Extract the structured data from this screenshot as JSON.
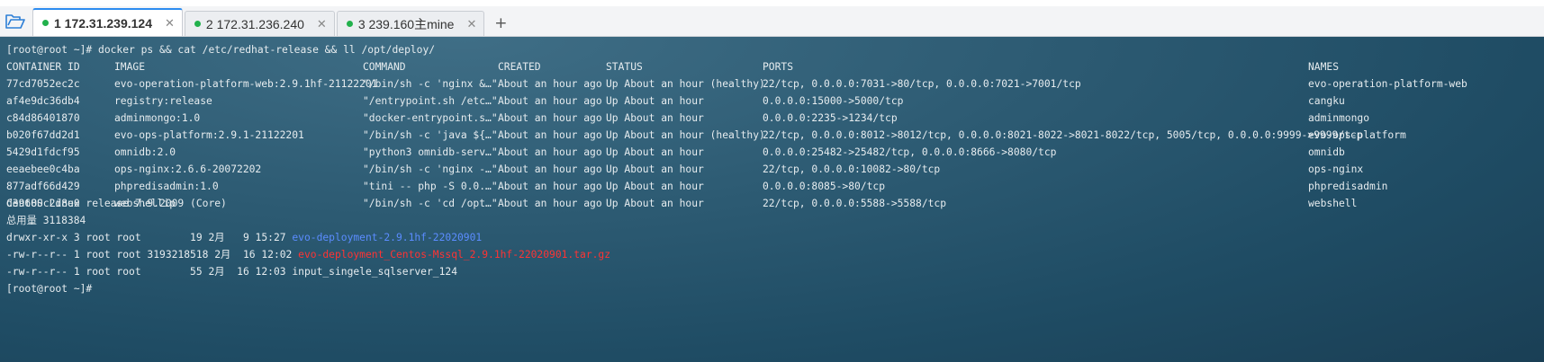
{
  "tabs": [
    {
      "label": "1 172.31.239.124",
      "active": true
    },
    {
      "label": "2 172.31.236.240",
      "active": false
    },
    {
      "label": "3 239.160主mine",
      "active": false
    }
  ],
  "add_tab_label": "+",
  "close_glyph": "✕",
  "terminal": {
    "command_line": "[root@root ~]# docker ps && cat /etc/redhat-release && ll /opt/deploy/",
    "docker_headers": {
      "id": "CONTAINER ID",
      "image": "IMAGE",
      "command": "COMMAND",
      "created": "CREATED",
      "status": "STATUS",
      "ports": "PORTS",
      "names": "NAMES"
    },
    "containers": [
      {
        "id": "77cd7052ec2c",
        "image": "evo-operation-platform-web:2.9.1hf-21122201",
        "command": "\"/bin/sh -c 'nginx &…\"",
        "created": "About an hour ago",
        "status": "Up About an hour (healthy)",
        "ports": "22/tcp, 0.0.0.0:7031->80/tcp, 0.0.0.0:7021->7001/tcp",
        "names": "evo-operation-platform-web"
      },
      {
        "id": "af4e9dc36db4",
        "image": "registry:release",
        "command": "\"/entrypoint.sh /etc…\"",
        "created": "About an hour ago",
        "status": "Up About an hour",
        "ports": "0.0.0.0:15000->5000/tcp",
        "names": "cangku"
      },
      {
        "id": "c84d86401870",
        "image": "adminmongo:1.0",
        "command": "\"docker-entrypoint.s…\"",
        "created": "About an hour ago",
        "status": "Up About an hour",
        "ports": "0.0.0.0:2235->1234/tcp",
        "names": "adminmongo"
      },
      {
        "id": "b020f67dd2d1",
        "image": "evo-ops-platform:2.9.1-21122201",
        "command": "\"/bin/sh -c 'java ${…\"",
        "created": "About an hour ago",
        "status": "Up About an hour (healthy)",
        "ports": "22/tcp, 0.0.0.0:8012->8012/tcp, 0.0.0.0:8021-8022->8021-8022/tcp, 5005/tcp, 0.0.0.0:9999->9999/tcp",
        "names": "evo-ops-platform"
      },
      {
        "id": "5429d1fdcf95",
        "image": "omnidb:2.0",
        "command": "\"python3 omnidb-serv…\"",
        "created": "About an hour ago",
        "status": "Up About an hour",
        "ports": "0.0.0.0:25482->25482/tcp, 0.0.0.0:8666->8080/tcp",
        "names": "omnidb"
      },
      {
        "id": "eeaebee0c4ba",
        "image": "ops-nginx:2.6.6-20072202",
        "command": "\"/bin/sh -c 'nginx -…\"",
        "created": "About an hour ago",
        "status": "Up About an hour",
        "ports": "22/tcp, 0.0.0.0:10082->80/tcp",
        "names": "ops-nginx"
      },
      {
        "id": "877adf66d429",
        "image": "phpredisadmin:1.0",
        "command": "\"tini -- php -S 0.0.…\"",
        "created": "About an hour ago",
        "status": "Up About an hour",
        "ports": "0.0.0.0:8085->80/tcp",
        "names": "phpredisadmin"
      },
      {
        "id": "d39680c2d8e0",
        "image": "webshellip",
        "command": "\"/bin/sh -c 'cd /opt…\"",
        "created": "About an hour ago",
        "status": "Up About an hour",
        "ports": "22/tcp, 0.0.0.0:5588->5588/tcp",
        "names": "webshell"
      }
    ],
    "release_line": "CentOS Linux release 7.9.2009 (Core)",
    "total_line": "总用量 3118384",
    "listing": [
      {
        "meta": "drwxr-xr-x 3 root root        19 2月   9 15:27 ",
        "name": "evo-deployment-2.9.1hf-22020901",
        "color": "blue"
      },
      {
        "meta": "-rw-r--r-- 1 root root 3193218518 2月  16 12:02 ",
        "name": "evo-deployment_Centos-Mssql_2.9.1hf-22020901.tar.gz",
        "color": "red"
      },
      {
        "meta": "-rw-r--r-- 1 root root        55 2月  16 12:03 ",
        "name": "input_singele_sqlserver_124",
        "color": "default"
      }
    ],
    "prompt_line": "[root@root ~]#"
  },
  "colors": {
    "terminal_text": "#e6ecef",
    "dir_blue": "#5b8cff",
    "archive_red": "#ff3333",
    "status_dot": "#22b14c",
    "active_tab_accent": "#2d8cf0"
  }
}
